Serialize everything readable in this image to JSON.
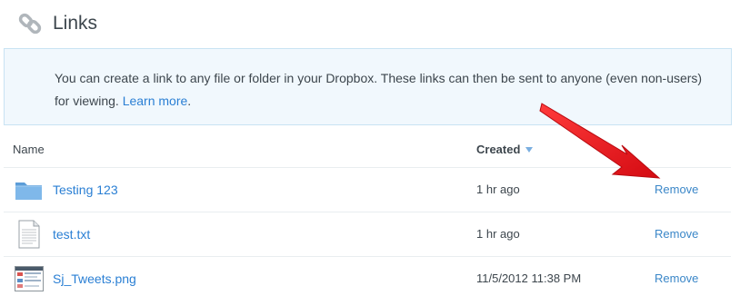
{
  "header": {
    "title": "Links",
    "icon": "link-icon"
  },
  "info": {
    "text": "You can create a link to any file or folder in your Dropbox. These links can then be sent to anyone (even non-users) for viewing.",
    "link_label": "Learn more",
    "link_suffix": "."
  },
  "table": {
    "columns": {
      "name": "Name",
      "created": "Created"
    },
    "sort": "Created descending",
    "rows": [
      {
        "name": "Testing 123",
        "created": "1 hr ago",
        "action": "Remove",
        "icon": "folder-icon"
      },
      {
        "name": "test.txt",
        "created": "1 hr ago",
        "action": "Remove",
        "icon": "text-file-icon"
      },
      {
        "name": "Sj_Tweets.png",
        "created": "11/5/2012 11:38 PM",
        "action": "Remove",
        "icon": "image-thumbnail-icon"
      }
    ]
  },
  "colors": {
    "link": "#2a7fd4",
    "info_bg": "#f1f8fd",
    "info_border": "#c9e3f3",
    "arrow": "#e8141b"
  }
}
